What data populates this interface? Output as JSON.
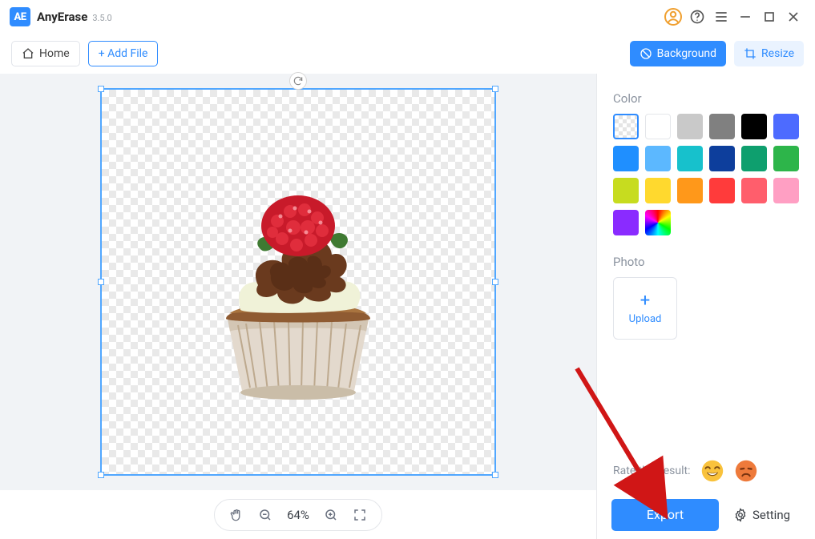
{
  "app": {
    "name": "AnyErase",
    "version": "3.5.0",
    "logo_text": "AE"
  },
  "toolbar": {
    "home_label": "Home",
    "add_file_label": "+ Add File",
    "background_label": "Background",
    "resize_label": "Resize"
  },
  "canvas": {
    "zoom_text": "64%"
  },
  "panel": {
    "color_heading": "Color",
    "colors": [
      "transparent",
      "white",
      "#C9C9C9",
      "#808080",
      "#000000",
      "#4D6BFF",
      "#1F8FFF",
      "#5CB8FF",
      "#17C1CC",
      "#0D3E9C",
      "#0E9F6E",
      "#2DB54A",
      "#C7DC1F",
      "#FFD92E",
      "#FF981A",
      "#FF3B3B",
      "#FF5E6C",
      "#FF9FC3",
      "#8A2BFF",
      "rainbow"
    ],
    "photo_heading": "Photo",
    "upload_label": "Upload",
    "rate_label": "Rate this result:"
  },
  "footer": {
    "export_label": "Export",
    "setting_label": "Setting"
  }
}
